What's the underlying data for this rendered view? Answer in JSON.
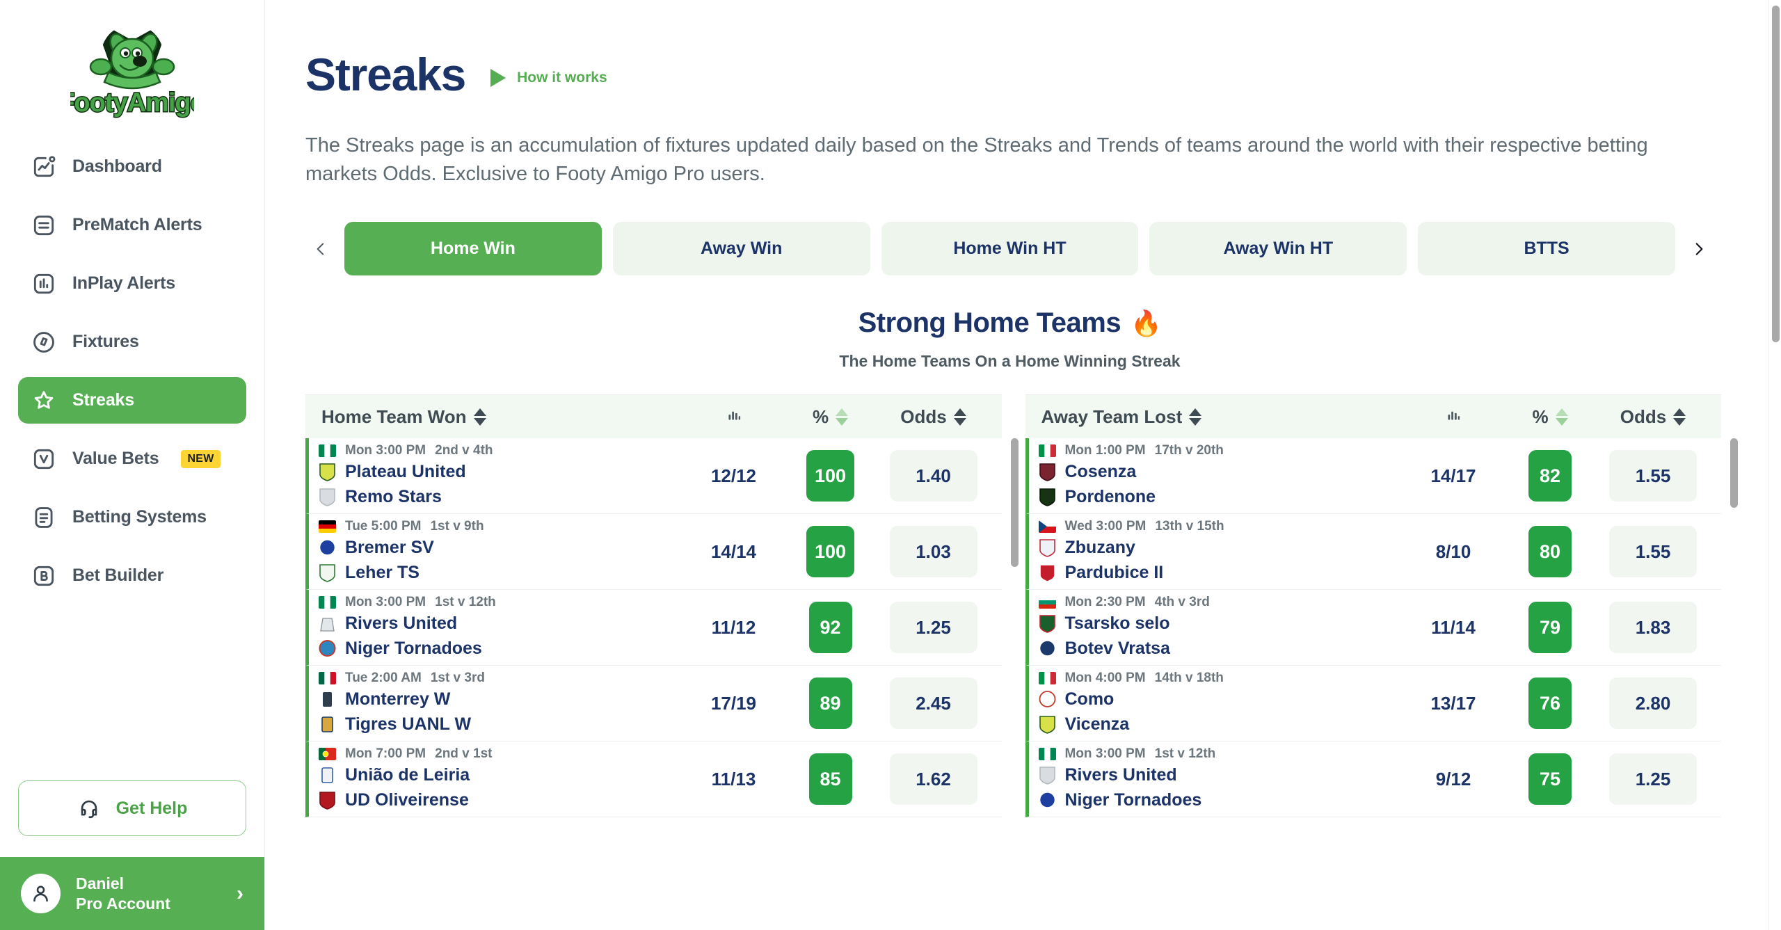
{
  "brand": {
    "name": "FootyAmigo",
    "logo_icon": "footy-amigo-dog-ball-logo"
  },
  "sidebar": {
    "items": [
      {
        "label": "Dashboard",
        "icon": "dashboard-chart-icon",
        "active": false,
        "badge": ""
      },
      {
        "label": "PreMatch Alerts",
        "icon": "list-lines-icon",
        "active": false,
        "badge": ""
      },
      {
        "label": "InPlay Alerts",
        "icon": "bar-chart-icon",
        "active": false,
        "badge": ""
      },
      {
        "label": "Fixtures",
        "icon": "compass-icon",
        "active": false,
        "badge": ""
      },
      {
        "label": "Streaks",
        "icon": "star-icon",
        "active": true,
        "badge": ""
      },
      {
        "label": "Value Bets",
        "icon": "letter-v-icon",
        "active": false,
        "badge": "NEW"
      },
      {
        "label": "Betting Systems",
        "icon": "document-lines-icon",
        "active": false,
        "badge": ""
      },
      {
        "label": "Bet Builder",
        "icon": "letter-b-icon",
        "active": false,
        "badge": ""
      }
    ],
    "help_button": {
      "label": "Get Help",
      "icon": "headset-icon"
    },
    "account": {
      "name": "Daniel",
      "plan": "Pro Account",
      "avatar_icon": "user-avatar-icon",
      "chevron": "›"
    }
  },
  "header": {
    "title": "Streaks",
    "how_it_works": {
      "label": "How it works",
      "icon": "play-triangle-icon"
    },
    "description": "The Streaks page is an accumulation of fixtures updated daily based on the Streaks and Trends of teams around the world with their respective betting markets Odds. Exclusive to Footy Amigo Pro users."
  },
  "tabs": {
    "prev_icon": "chevron-left-icon",
    "next_icon": "chevron-right-icon",
    "items": [
      {
        "label": "Home Win",
        "active": true
      },
      {
        "label": "Away Win",
        "active": false
      },
      {
        "label": "Home Win HT",
        "active": false
      },
      {
        "label": "Away Win HT",
        "active": false
      },
      {
        "label": "BTTS",
        "active": false
      }
    ]
  },
  "section": {
    "title": "Strong Home Teams",
    "title_emoji": "🔥",
    "subtitle": "The Home Teams On a Home Winning Streak"
  },
  "colors": {
    "brand_green": "#56af53",
    "pill_green": "#25a244",
    "title_navy": "#1c3368",
    "badge_yellow": "#fcd535",
    "tab_inactive": "#edf5ed"
  },
  "tables": [
    {
      "id": "home-team-won",
      "headers": {
        "name": "Home Team Won",
        "bars_icon": "bar-chart-icon",
        "pct": "%",
        "odds": "Odds"
      },
      "rows": [
        {
          "flag": "nigeria",
          "time": "Mon 3:00 PM",
          "positions": "2nd v 4th",
          "home": "Plateau United",
          "away": "Remo Stars",
          "record": "12/12",
          "pct": "100",
          "odds": "1.40"
        },
        {
          "flag": "germany",
          "time": "Tue 5:00 PM",
          "positions": "1st v 9th",
          "home": "Bremer SV",
          "away": "Leher TS",
          "record": "14/14",
          "pct": "100",
          "odds": "1.03"
        },
        {
          "flag": "nigeria",
          "time": "Mon 3:00 PM",
          "positions": "1st v 12th",
          "home": "Rivers United",
          "away": "Niger Tornadoes",
          "record": "11/12",
          "pct": "92",
          "odds": "1.25"
        },
        {
          "flag": "mexico",
          "time": "Tue 2:00 AM",
          "positions": "1st v 3rd",
          "home": "Monterrey W",
          "away": "Tigres UANL W",
          "record": "17/19",
          "pct": "89",
          "odds": "2.45"
        },
        {
          "flag": "portugal",
          "time": "Mon 7:00 PM",
          "positions": "2nd v 1st",
          "home": "União de Leiria",
          "away": "UD Oliveirense",
          "record": "11/13",
          "pct": "85",
          "odds": "1.62"
        }
      ]
    },
    {
      "id": "away-team-lost",
      "headers": {
        "name": "Away Team Lost",
        "bars_icon": "bar-chart-icon",
        "pct": "%",
        "odds": "Odds"
      },
      "rows": [
        {
          "flag": "italy",
          "time": "Mon 1:00 PM",
          "positions": "17th v 20th",
          "home": "Cosenza",
          "away": "Pordenone",
          "record": "14/17",
          "pct": "82",
          "odds": "1.55"
        },
        {
          "flag": "czechia",
          "time": "Wed 3:00 PM",
          "positions": "13th v 15th",
          "home": "Zbuzany",
          "away": "Pardubice II",
          "record": "8/10",
          "pct": "80",
          "odds": "1.55"
        },
        {
          "flag": "bulgaria",
          "time": "Mon 2:30 PM",
          "positions": "4th v 3rd",
          "home": "Tsarsko selo",
          "away": "Botev Vratsa",
          "record": "11/14",
          "pct": "79",
          "odds": "1.83"
        },
        {
          "flag": "italy",
          "time": "Mon 4:00 PM",
          "positions": "14th v 18th",
          "home": "Como",
          "away": "Vicenza",
          "record": "13/17",
          "pct": "76",
          "odds": "2.80"
        },
        {
          "flag": "nigeria",
          "time": "Mon 3:00 PM",
          "positions": "1st v 12th",
          "home": "Rivers United",
          "away": "Niger Tornadoes",
          "record": "9/12",
          "pct": "75",
          "odds": "1.25"
        }
      ]
    }
  ]
}
